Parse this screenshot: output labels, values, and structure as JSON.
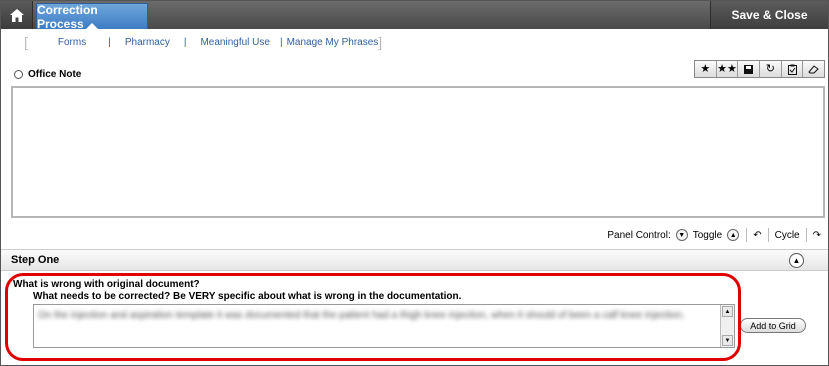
{
  "header": {
    "home_icon": "home-icon",
    "active_tab": "Correction Process",
    "save_close": "Save & Close"
  },
  "nav": {
    "links": [
      "Forms",
      "Pharmacy",
      "Meaningful Use",
      "Manage My Phrases"
    ]
  },
  "note": {
    "label": "Office Note",
    "toolbar_icons": [
      "star-icon",
      "double-star-icon",
      "save-icon",
      "refresh-icon",
      "clipboard-icon",
      "eraser-icon"
    ]
  },
  "panel_control": {
    "label": "Panel Control:",
    "toggle": "Toggle",
    "cycle": "Cycle"
  },
  "step": {
    "title": "Step One",
    "question1": "What is wrong with original document?",
    "question2": "What needs to be corrected?  Be VERY specific about what is wrong in the documentation.",
    "answer": "On the injection and aspiration template it was documented that the patient had a thigh knee injection, when it should of been a calf knee injection.",
    "add_button": "Add to Grid"
  },
  "colors": {
    "accent": "#3d7cc4",
    "highlight": "#e00000",
    "link": "#2f5f9e"
  }
}
